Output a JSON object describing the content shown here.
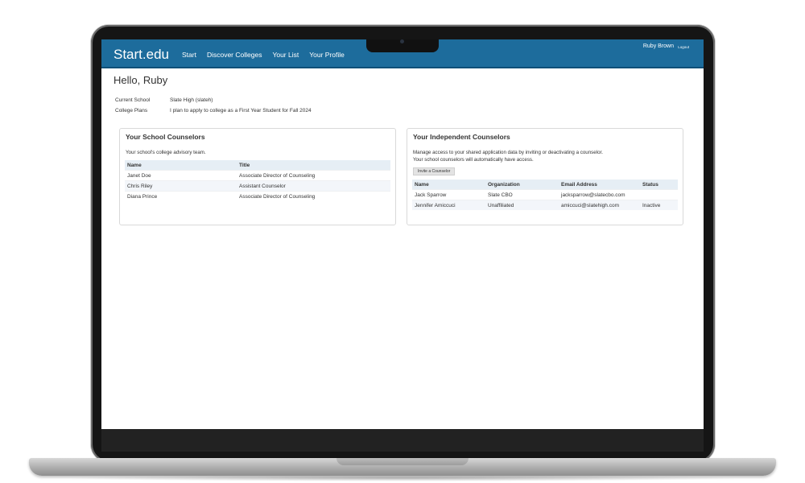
{
  "header": {
    "brand": "Start.edu",
    "nav": [
      "Start",
      "Discover Colleges",
      "Your List",
      "Your Profile"
    ],
    "user_name": "Ruby Brown",
    "logout_label": "Logout"
  },
  "greeting": "Hello, Ruby",
  "student": {
    "current_school_label": "Current School",
    "current_school": "Slate High (slateh)",
    "college_plans_label": "College Plans",
    "college_plans": "I plan to apply to college as a First Year Student for Fall 2024"
  },
  "school_counselors": {
    "title": "Your School Counselors",
    "description": "Your school's college advisory team.",
    "columns": [
      "Name",
      "Title"
    ],
    "rows": [
      [
        "Janet Doe",
        "Associate Director of Counseling"
      ],
      [
        "Chris Riley",
        "Assistant Counselor"
      ],
      [
        "Diana Prince",
        "Associate Director of Counseling"
      ]
    ]
  },
  "independent_counselors": {
    "title": "Your Independent Counselors",
    "description_1": "Manage access to your shared application data by inviting or deactivating a counselor.",
    "description_2": "Your school counselors will automatically have access.",
    "invite_label": "Invite a Counselor",
    "columns": [
      "Name",
      "Organization",
      "Email Address",
      "Status"
    ],
    "rows": [
      [
        "Jack Sparrow",
        "Slate CBO",
        "jacksparrow@slatecbo.com",
        ""
      ],
      [
        "Jennifer Amiccuci",
        "Unaffiliated",
        "amiccuci@slatehigh.com",
        "Inactive"
      ]
    ]
  }
}
